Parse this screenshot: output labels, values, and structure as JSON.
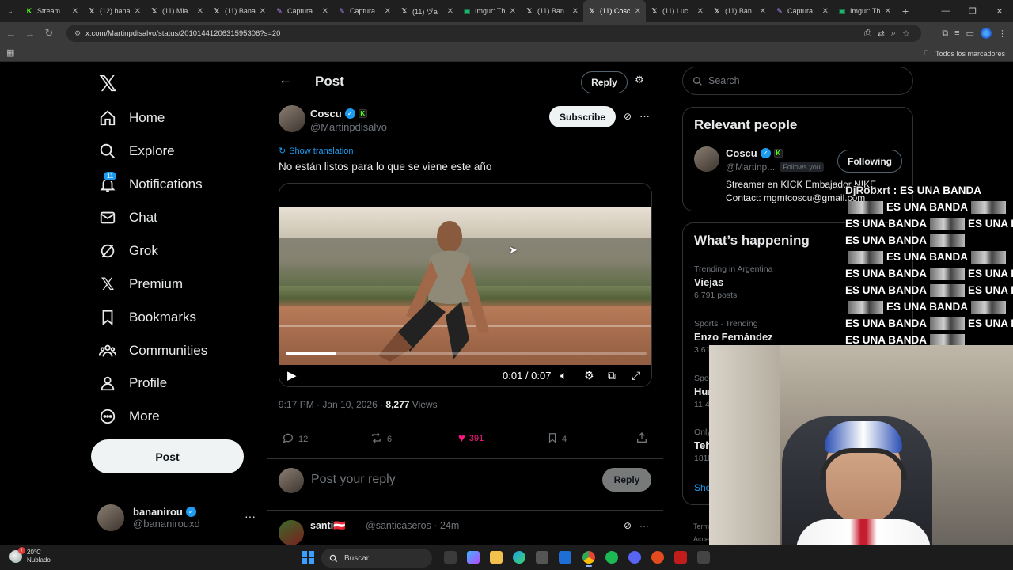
{
  "browser": {
    "tabs": [
      {
        "label": "Stream",
        "icon": "kick-favicon",
        "color": "#53fc18"
      },
      {
        "label": "(12) bana",
        "icon": "x-favicon",
        "color": "#ffffff"
      },
      {
        "label": "(11) Mia",
        "icon": "x-favicon",
        "color": "#ffffff"
      },
      {
        "label": "(11) Bana",
        "icon": "x-favicon",
        "color": "#ffffff"
      },
      {
        "label": "Captura",
        "icon": "captura-favicon",
        "color": "#b48cff"
      },
      {
        "label": "Captura",
        "icon": "captura-favicon",
        "color": "#b48cff"
      },
      {
        "label": "(11) ヅa",
        "icon": "x-favicon",
        "color": "#ffffff"
      },
      {
        "label": "Imgur: Th",
        "icon": "imgur-favicon",
        "color": "#1bb76e"
      },
      {
        "label": "(11) Ban",
        "icon": "x-favicon",
        "color": "#ffffff"
      },
      {
        "label": "(11) Cosc",
        "icon": "x-favicon",
        "color": "#ffffff",
        "active": true
      },
      {
        "label": "(11) Luc",
        "icon": "x-favicon",
        "color": "#ffffff"
      },
      {
        "label": "(11) Ban",
        "icon": "x-favicon",
        "color": "#ffffff"
      },
      {
        "label": "Captura",
        "icon": "captura-favicon",
        "color": "#b48cff"
      },
      {
        "label": "Imgur: Th",
        "icon": "imgur-favicon",
        "color": "#1bb76e"
      }
    ],
    "url": "x.com/Martinpdisalvo/status/2010144120631595306?s=20",
    "bookmarks_label": "Todos los marcadores"
  },
  "nav": {
    "items": [
      {
        "label": "Home",
        "icon": "home-icon"
      },
      {
        "label": "Explore",
        "icon": "search-icon"
      },
      {
        "label": "Notifications",
        "icon": "bell-icon",
        "badge": "11"
      },
      {
        "label": "Chat",
        "icon": "mail-icon"
      },
      {
        "label": "Grok",
        "icon": "grok-icon"
      },
      {
        "label": "Premium",
        "icon": "x-premium-icon"
      },
      {
        "label": "Bookmarks",
        "icon": "bookmark-icon"
      },
      {
        "label": "Communities",
        "icon": "communities-icon"
      },
      {
        "label": "Profile",
        "icon": "profile-icon"
      },
      {
        "label": "More",
        "icon": "more-circle-icon"
      }
    ],
    "post_button": "Post",
    "account": {
      "name": "bananirou",
      "handle": "@bananirouxd"
    }
  },
  "post": {
    "header_title": "Post",
    "reply_label": "Reply",
    "author_name": "Coscu",
    "author_handle": "@Martinpdisalvo",
    "subscribe_label": "Subscribe",
    "show_translation": "Show translation",
    "text": "No están listos para lo que se viene este año",
    "video": {
      "time": "0:01 / 0:07",
      "progress": 0.14
    },
    "timestamp": "9:17 PM · Jan 10, 2026 · ",
    "views_count": "8,277",
    "views_label": " Views",
    "replies": "12",
    "reposts": "6",
    "likes": "391",
    "bookmarks": "4",
    "reply_placeholder": "Post your reply",
    "reply_button": "Reply"
  },
  "first_reply": {
    "name": "santi🇦🇹",
    "handle": "@santicaseros · 24m"
  },
  "sidebar": {
    "search_placeholder": "Search",
    "relevant_title": "Relevant people",
    "person": {
      "name": "Coscu",
      "handle": "@Martinp...",
      "follows_you": "Follows you",
      "following_label": "Following",
      "bio_line1": "Streamer en KICK Embajador NIKE",
      "bio_line2": "Contact: mgmtcoscu@gmail.com"
    },
    "happening_title": "What’s happening",
    "trends": [
      {
        "context": "Trending in Argentina",
        "name": "Viejas",
        "count": "6,791 posts"
      },
      {
        "context": "Sports · Trending",
        "name": "Enzo Fernández",
        "count": "3,61"
      },
      {
        "context": "Spo",
        "name": "Hur",
        "count": "11,4"
      },
      {
        "context": "Only",
        "name": "Teh",
        "count": "181K"
      }
    ],
    "show_more": "Sho",
    "terms": [
      "Term",
      "Acce"
    ]
  },
  "overlay": {
    "chat_user": "DjRobxrt",
    "chat_first": " : ES UNA BANDA",
    "chat_phrase": "ES UNA BANDA"
  },
  "taskbar": {
    "temperature": "20°C",
    "condition": "Nublado",
    "search_label": "Buscar"
  }
}
